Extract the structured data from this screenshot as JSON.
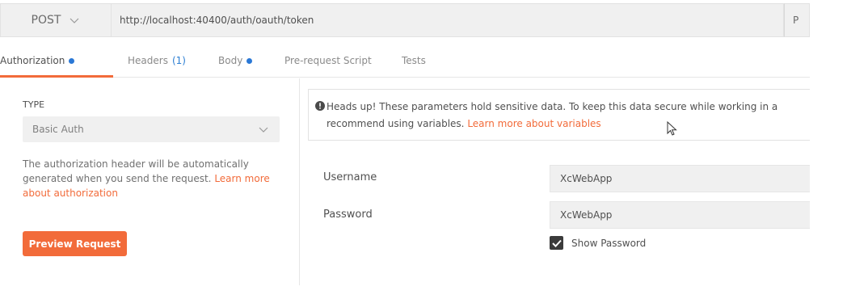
{
  "request": {
    "method": "POST",
    "url": "http://localhost:40400/auth/oauth/token",
    "params_label": "P"
  },
  "tabs": [
    {
      "label": "Authorization",
      "has_dot": true,
      "active": true
    },
    {
      "label": "Headers",
      "count": "(1)"
    },
    {
      "label": "Body",
      "has_dot": true
    },
    {
      "label": "Pre-request Script"
    },
    {
      "label": "Tests"
    }
  ],
  "left": {
    "type_label": "TYPE",
    "type_value": "Basic Auth",
    "desc_text": "The authorization header will be automatically generated when you send the request. ",
    "desc_link": "Learn more about authorization",
    "preview_button": "Preview Request"
  },
  "alert": {
    "line1": "Heads up! These parameters hold sensitive data. To keep this data secure while working in a",
    "line2_text": "recommend using variables. ",
    "line2_link": "Learn more about variables"
  },
  "fields": {
    "username_label": "Username",
    "username_value": "XcWebApp",
    "password_label": "Password",
    "password_value": "XcWebApp"
  },
  "show_password": {
    "label": "Show Password",
    "checked": true
  },
  "colors": {
    "accent": "#f26b3a",
    "dot_blue": "#2a78d6",
    "input_bg": "#f0f0f0"
  }
}
